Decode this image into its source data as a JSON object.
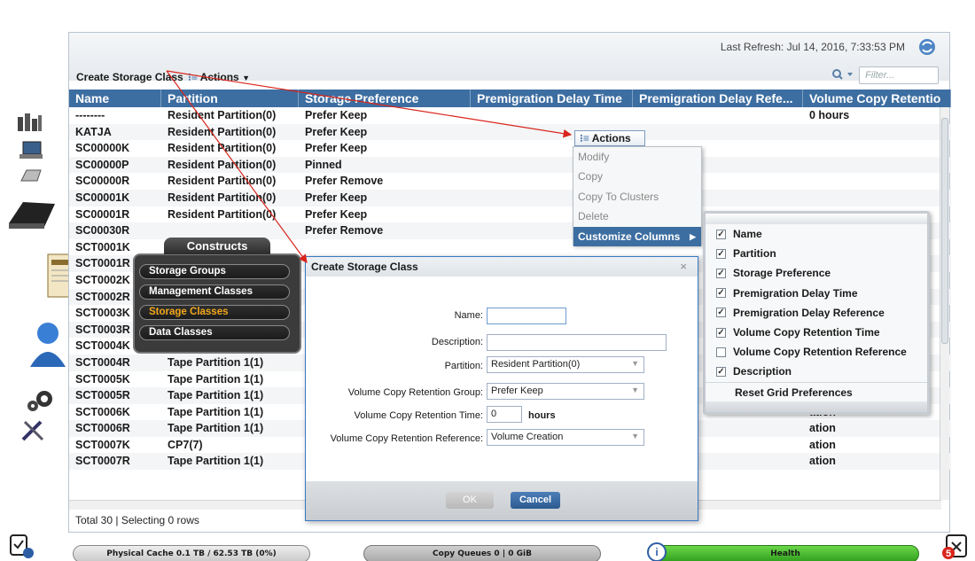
{
  "header": {
    "last_refresh_label": "Last Refresh:",
    "last_refresh_value": "Jul 14, 2016, 7:33:53 PM",
    "filter_placeholder": "Filter..."
  },
  "toolbar": {
    "create_label": "Create Storage Class",
    "actions_label": "Actions"
  },
  "grid": {
    "columns": [
      "Name",
      "Partition",
      "Storage Preference",
      "Premigration Delay Time",
      "Premigration Delay Refe...",
      "Volume Copy Retentio"
    ],
    "rows": [
      [
        "--------",
        "Resident Partition(0)",
        "Prefer Keep",
        "",
        "",
        "0 hours"
      ],
      [
        "KATJA",
        "Resident Partition(0)",
        "Prefer Keep",
        "",
        "",
        ""
      ],
      [
        "SC00000K",
        "Resident Partition(0)",
        "Prefer Keep",
        "",
        "",
        ""
      ],
      [
        "SC00000P",
        "Resident Partition(0)",
        "Pinned",
        "",
        "",
        ""
      ],
      [
        "SC00000R",
        "Resident Partition(0)",
        "Prefer Remove",
        "",
        "",
        ""
      ],
      [
        "SC00001K",
        "Resident Partition(0)",
        "Prefer Keep",
        "",
        "",
        ""
      ],
      [
        "SC00001R",
        "Resident Partition(0)",
        "Prefer Keep",
        "",
        "",
        ""
      ],
      [
        "SC00030R",
        "",
        "Prefer Remove",
        "",
        "",
        ""
      ],
      [
        "SCT0001K",
        "",
        "",
        "",
        "",
        ""
      ],
      [
        "SCT0001R",
        "",
        "",
        "",
        "",
        ""
      ],
      [
        "SCT0002K",
        "",
        "",
        "",
        "",
        ""
      ],
      [
        "SCT0002R",
        "",
        "",
        "",
        "",
        ""
      ],
      [
        "SCT0003K",
        "",
        "",
        "",
        "",
        ""
      ],
      [
        "SCT0003R",
        "",
        "",
        "",
        "",
        ""
      ],
      [
        "SCT0004K",
        "Tape Partition 1(1)",
        "",
        "",
        "",
        ""
      ],
      [
        "SCT0004R",
        "Tape Partition 1(1)",
        "",
        "",
        "",
        ""
      ],
      [
        "SCT0005K",
        "Tape Partition 1(1)",
        "",
        "",
        "",
        ""
      ],
      [
        "SCT0005R",
        "Tape Partition 1(1)",
        "",
        "",
        "",
        ""
      ],
      [
        "SCT0006K",
        "Tape Partition 1(1)",
        "",
        "",
        "",
        "ation"
      ],
      [
        "SCT0006R",
        "Tape Partition 1(1)",
        "",
        "",
        "",
        "ation"
      ],
      [
        "SCT0007K",
        "CP7(7)",
        "",
        "",
        "",
        "ation"
      ],
      [
        "SCT0007R",
        "Tape Partition 1(1)",
        "",
        "",
        "",
        "ation"
      ]
    ],
    "status": "Total 30 | Selecting 0 rows"
  },
  "actions_menu": {
    "button_label": "Actions",
    "items": [
      "Modify",
      "Copy",
      "Copy To Clusters",
      "Delete",
      "Customize Columns"
    ]
  },
  "columns_menu": {
    "items": [
      {
        "label": "Name",
        "checked": "✓"
      },
      {
        "label": "Partition",
        "checked": "✓"
      },
      {
        "label": "Storage Preference",
        "checked": "✓"
      },
      {
        "label": "Premigration Delay Time",
        "checked": "✓"
      },
      {
        "label": "Premigration Delay Reference",
        "checked": "✓"
      },
      {
        "label": "Volume Copy Retention Time",
        "checked": "✓"
      },
      {
        "label": "Volume Copy Retention Reference",
        "checked": ""
      },
      {
        "label": "Description",
        "checked": "✓"
      }
    ],
    "reset_label": "Reset Grid Preferences"
  },
  "constructs": {
    "title": "Constructs",
    "items": [
      "Storage Groups",
      "Management Classes",
      "Storage Classes",
      "Data Classes"
    ],
    "selected_color": "#f2a81c"
  },
  "dialog": {
    "title": "Create Storage Class",
    "close": "×",
    "labels": {
      "name": "Name:",
      "description": "Description:",
      "partition": "Partition:",
      "retention_group": "Volume Copy Retention Group:",
      "retention_time": "Volume Copy Retention Time:",
      "retention_reference": "Volume Copy Retention Reference:"
    },
    "values": {
      "name": "",
      "description": "",
      "partition": "Resident Partition(0)",
      "retention_group": "Prefer Keep",
      "retention_time": "0",
      "retention_time_unit": "hours",
      "retention_reference": "Volume Creation"
    },
    "ok_label": "OK",
    "cancel_label": "Cancel"
  },
  "status_bar": {
    "physical_cache": "Physical Cache 0.1 TB / 62.53 TB (0%)",
    "copy_queues": "Copy Queues 0 | 0 GiB",
    "health": "Health",
    "alert_count": "5"
  },
  "colors": {
    "grid_header": "#3d6ea1",
    "health_green": "#4cba2c",
    "annotation_red": "#d9241b"
  }
}
